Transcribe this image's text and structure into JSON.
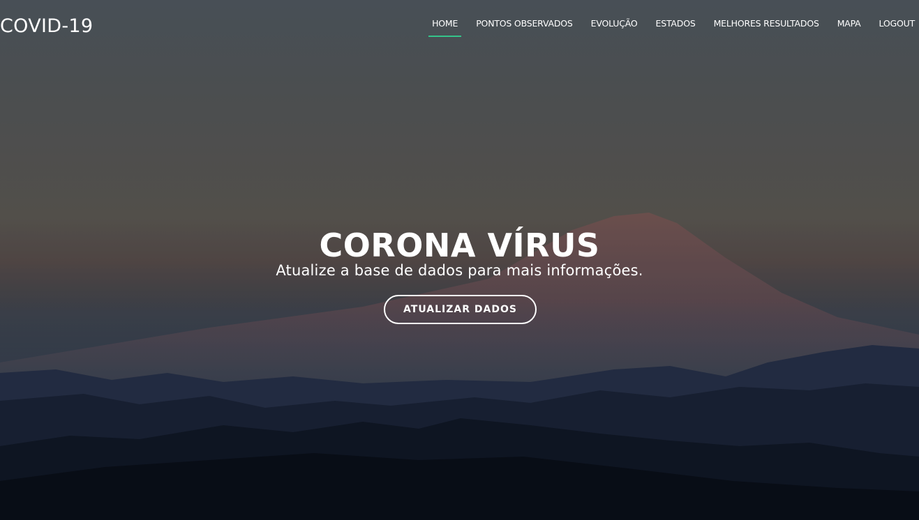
{
  "brand": {
    "name": "COVID-19"
  },
  "nav": {
    "items": [
      {
        "label": "HOME",
        "active": true
      },
      {
        "label": "PONTOS OBSERVADOS",
        "active": false
      },
      {
        "label": "EVOLUÇÃO",
        "active": false
      },
      {
        "label": "ESTADOS",
        "active": false
      },
      {
        "label": "MELHORES RESULTADOS",
        "active": false
      },
      {
        "label": "MAPA",
        "active": false
      },
      {
        "label": "LOGOUT",
        "active": false
      }
    ],
    "active_indicator_color": "#34c48a"
  },
  "hero": {
    "title": "CORONA VÍRUS",
    "subtitle": "Atualize a base de dados para mais informações.",
    "button_label": "ATUALIZAR DADOS"
  }
}
